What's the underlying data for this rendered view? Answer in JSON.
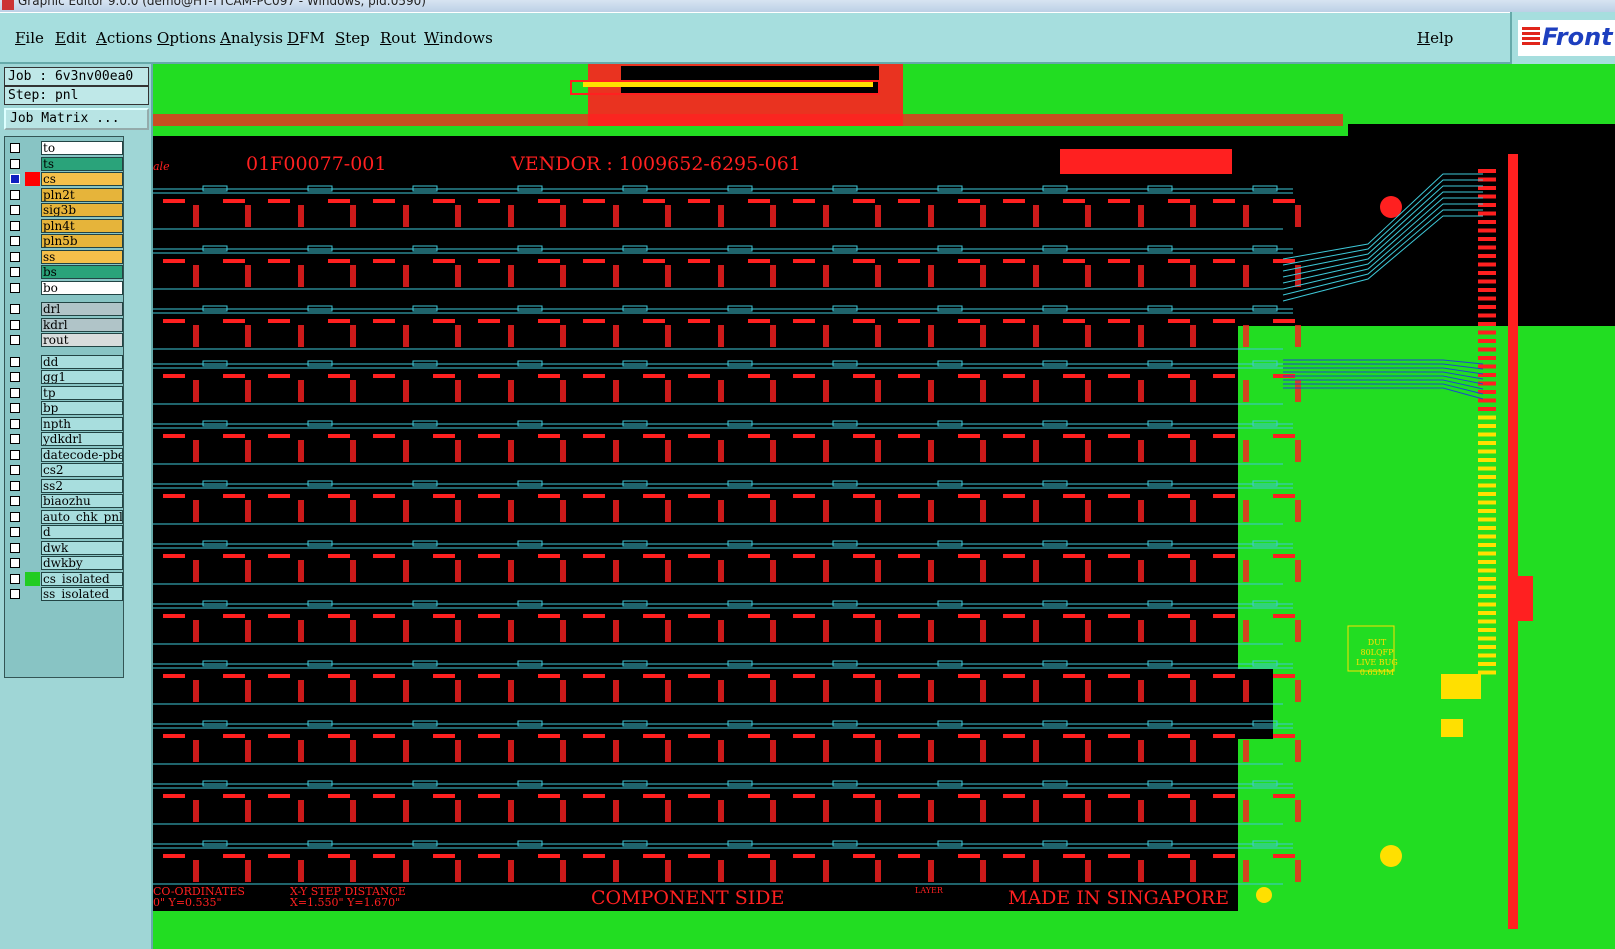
{
  "window": {
    "title": "Graphic Editor 9.0.0 (demo@HT-TTCAM-PC097 - Windows, pid:0590)"
  },
  "menu": {
    "items": [
      "File",
      "Edit",
      "Actions",
      "Options",
      "Analysis",
      "DFM",
      "Step",
      "Rout",
      "Windows"
    ],
    "help": "Help"
  },
  "logo": {
    "text": "Front"
  },
  "job": {
    "label": "Job : 6v3nv00ea0",
    "step": "Step: pnl",
    "matrix_button": "Job Matrix ..."
  },
  "layers": [
    {
      "name": "to",
      "color": "#ffffff",
      "swatch": ""
    },
    {
      "name": "ts",
      "color": "#2aa37a",
      "swatch": ""
    },
    {
      "name": "cs",
      "color": "#f6c04a",
      "swatch": "#ff0000",
      "active": true
    },
    {
      "name": "pln2t",
      "color": "#e6b43a",
      "swatch": ""
    },
    {
      "name": "sig3b",
      "color": "#e6b43a",
      "swatch": ""
    },
    {
      "name": "pln4t",
      "color": "#e6b43a",
      "swatch": ""
    },
    {
      "name": "pln5b",
      "color": "#e6b43a",
      "swatch": ""
    },
    {
      "name": "ss",
      "color": "#f6c04a",
      "swatch": ""
    },
    {
      "name": "bs",
      "color": "#2aa37a",
      "swatch": ""
    },
    {
      "name": "bo",
      "color": "#ffffff",
      "swatch": ""
    },
    {
      "name": "drl",
      "color": "#b0c4c8",
      "swatch": ""
    },
    {
      "name": "kdrl",
      "color": "#b0c4c8",
      "swatch": ""
    },
    {
      "name": "rout",
      "color": "#d8dcdc",
      "swatch": ""
    },
    {
      "name": "dd",
      "color": "#a8dede",
      "swatch": ""
    },
    {
      "name": "gg1",
      "color": "#a8dede",
      "swatch": ""
    },
    {
      "name": "tp",
      "color": "#a8dede",
      "swatch": ""
    },
    {
      "name": "bp",
      "color": "#a8dede",
      "swatch": ""
    },
    {
      "name": "npth",
      "color": "#a8dede",
      "swatch": ""
    },
    {
      "name": "ydkdrl",
      "color": "#a8dede",
      "swatch": ""
    },
    {
      "name": "datecode-pbe",
      "color": "#a8dede",
      "swatch": ""
    },
    {
      "name": "cs2",
      "color": "#a8dede",
      "swatch": ""
    },
    {
      "name": "ss2",
      "color": "#a8dede",
      "swatch": ""
    },
    {
      "name": "biaozhu",
      "color": "#a8dede",
      "swatch": ""
    },
    {
      "name": "auto_chk_pnl",
      "color": "#a8dede",
      "swatch": ""
    },
    {
      "name": "d",
      "color": "#a8dede",
      "swatch": ""
    },
    {
      "name": "dwk",
      "color": "#a8dede",
      "swatch": ""
    },
    {
      "name": "dwkby",
      "color": "#a8dede",
      "swatch": ""
    },
    {
      "name": "cs_isolated",
      "color": "#a8dede",
      "swatch": "#22cc22"
    },
    {
      "name": "ss_isolated",
      "color": "#a8dede",
      "swatch": ""
    }
  ],
  "canvas": {
    "part_no": "01F00077-001",
    "vendor": "VENDOR : 1009652-6295-061",
    "side": "COMPONENT SIDE",
    "made_in": "MADE IN SINGAPORE",
    "coord_label": "CO-ORDINATES",
    "coord_value": "0\"  Y=0.535\"",
    "step_label": "X-Y STEP DISTANCE",
    "step_value": "X=1.550\"  Y=1.670\"",
    "layer_label": "LAYER",
    "left_fragment": "ale",
    "dut_lines": [
      "DUT",
      "80LQFP",
      "LIVE BUG",
      "0.65MM"
    ],
    "colors": {
      "background": "#000000",
      "copper": "#ff2020",
      "trace": "#3ec8d8",
      "solder": "#22dd22",
      "pad": "#ffe000"
    }
  }
}
